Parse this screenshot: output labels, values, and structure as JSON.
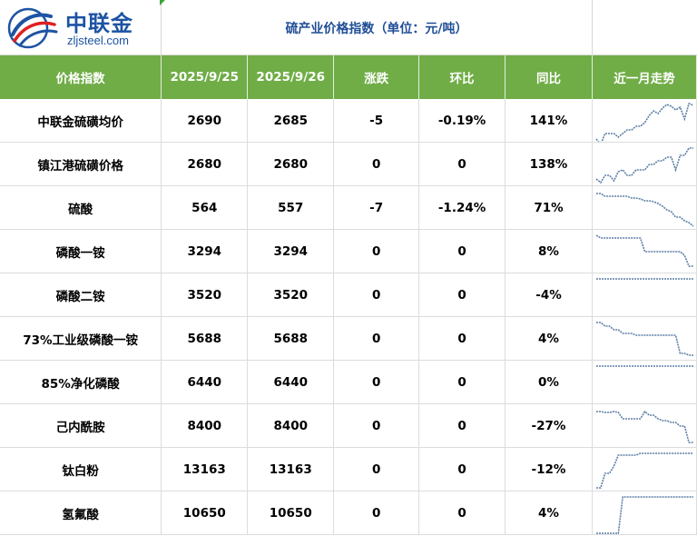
{
  "brand": {
    "name": "中联金",
    "url": "zljsteel.com"
  },
  "title": "硫产业价格指数（单位：元/吨）",
  "headers": [
    "价格指数",
    "2025/9/25",
    "2025/9/26",
    "涨跌",
    "环比",
    "同比",
    "近一月走势"
  ],
  "rows": [
    {
      "name": "中联金硫磺均价",
      "d1": "2690",
      "d2": "2685",
      "change": "-5",
      "mom": "-0.19%",
      "yoy": "141%",
      "trend": [
        40,
        46,
        34,
        34,
        34,
        38,
        34,
        30,
        30,
        26,
        26,
        22,
        14,
        9,
        12,
        6,
        2,
        4,
        8,
        5,
        18,
        1,
        3
      ]
    },
    {
      "name": "镇江港硫磺价格",
      "d1": "2680",
      "d2": "2680",
      "change": "0",
      "mom": "0",
      "yoy": "138%",
      "trend": [
        36,
        40,
        32,
        32,
        38,
        28,
        26,
        32,
        32,
        26,
        26,
        26,
        20,
        20,
        16,
        16,
        12,
        12,
        26,
        10,
        10,
        2,
        2
      ]
    },
    {
      "name": "硫酸",
      "d1": "564",
      "d2": "557",
      "change": "-7",
      "mom": "-1.24%",
      "yoy": "71%",
      "trend": [
        4,
        4,
        7,
        7,
        7,
        7,
        7,
        7,
        9,
        9,
        10,
        12,
        12,
        13,
        15,
        18,
        22,
        24,
        30,
        30,
        34,
        36,
        40
      ]
    },
    {
      "name": "磷酸一铵",
      "d1": "3294",
      "d2": "3294",
      "change": "0",
      "mom": "0",
      "yoy": "8%",
      "trend": [
        2,
        5,
        5,
        5,
        5,
        5,
        5,
        5,
        5,
        5,
        5,
        20,
        20,
        20,
        20,
        20,
        20,
        20,
        20,
        20,
        24,
        36,
        36
      ]
    },
    {
      "name": "磷酸二铵",
      "d1": "3520",
      "d2": "3520",
      "change": "0",
      "mom": "0",
      "yoy": "-4%",
      "trend": [
        2,
        2,
        2,
        2,
        2,
        2,
        2,
        2,
        2,
        2,
        2,
        2,
        2,
        2,
        2,
        2,
        2,
        2,
        2,
        2,
        2,
        2,
        2
      ]
    },
    {
      "name": "73%工业级磷酸一铵",
      "d1": "5688",
      "d2": "5688",
      "change": "0",
      "mom": "0",
      "yoy": "4%",
      "trend": [
        2,
        2,
        6,
        6,
        10,
        10,
        14,
        14,
        14,
        16,
        16,
        16,
        16,
        16,
        16,
        16,
        16,
        16,
        16,
        36,
        36,
        38,
        38
      ]
    },
    {
      "name": "85%净化磷酸",
      "d1": "6440",
      "d2": "6440",
      "change": "0",
      "mom": "0",
      "yoy": "0%",
      "trend": [
        2,
        2,
        2,
        2,
        2,
        2,
        2,
        2,
        2,
        2,
        2,
        2,
        2,
        2,
        2,
        2,
        2,
        2,
        2,
        2,
        2,
        2,
        2
      ]
    },
    {
      "name": "己内酰胺",
      "d1": "8400",
      "d2": "8400",
      "change": "0",
      "mom": "0",
      "yoy": "-27%",
      "trend": [
        4,
        4,
        5,
        5,
        4,
        5,
        12,
        12,
        12,
        12,
        12,
        4,
        8,
        8,
        12,
        14,
        14,
        16,
        16,
        20,
        20,
        38,
        38
      ]
    },
    {
      "name": "钛白粉",
      "d1": "13163",
      "d2": "13163",
      "change": "0",
      "mom": "0",
      "yoy": "-12%",
      "trend": [
        40,
        40,
        24,
        24,
        16,
        4,
        4,
        4,
        4,
        4,
        2,
        2,
        2,
        2,
        2,
        2,
        2,
        2,
        2,
        2,
        2,
        2,
        2
      ]
    },
    {
      "name": "氢氟酸",
      "d1": "10650",
      "d2": "10650",
      "change": "0",
      "mom": "0",
      "yoy": "4%",
      "trend": [
        42,
        42,
        42,
        42,
        42,
        42,
        2,
        2,
        2,
        2,
        2,
        2,
        2,
        2,
        2,
        2,
        2,
        2,
        2,
        2,
        2,
        2,
        2
      ]
    }
  ],
  "colors": {
    "header_bg": "#70ad47",
    "title_text": "#1f4e96",
    "brand_blue": "#1d53a3",
    "logo_red": "#e02020",
    "spark_line": "#5b7fa6"
  }
}
